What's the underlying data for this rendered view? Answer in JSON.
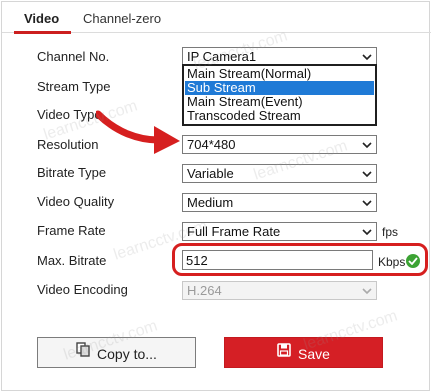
{
  "tabs": [
    {
      "label": "Video",
      "active": true
    },
    {
      "label": "Channel-zero",
      "active": false
    }
  ],
  "form": {
    "channel_no": {
      "label": "Channel No.",
      "value": "IP Camera1"
    },
    "stream_type": {
      "label": "Stream Type",
      "options": [
        "Main Stream(Normal)",
        "Sub Stream",
        "Main Stream(Event)",
        "Transcoded Stream"
      ],
      "highlighted": "Sub Stream"
    },
    "video_type": {
      "label": "Video Type"
    },
    "resolution": {
      "label": "Resolution",
      "value": "704*480"
    },
    "bitrate_type": {
      "label": "Bitrate Type",
      "value": "Variable"
    },
    "video_quality": {
      "label": "Video Quality",
      "value": "Medium"
    },
    "frame_rate": {
      "label": "Frame Rate",
      "value": "Full Frame Rate",
      "unit": "fps"
    },
    "max_bitrate": {
      "label": "Max. Bitrate",
      "value": "512",
      "unit": "Kbps"
    },
    "video_encoding": {
      "label": "Video Encoding",
      "value": "H.264",
      "disabled": true
    }
  },
  "buttons": {
    "copy_label": "Copy to...",
    "save_label": "Save"
  },
  "watermark_text": "learncctv.com",
  "colors": {
    "accent": "#d51f25",
    "selection": "#1f7ad6",
    "success": "#3ca334",
    "highlight_ring": "#d61f1f"
  }
}
